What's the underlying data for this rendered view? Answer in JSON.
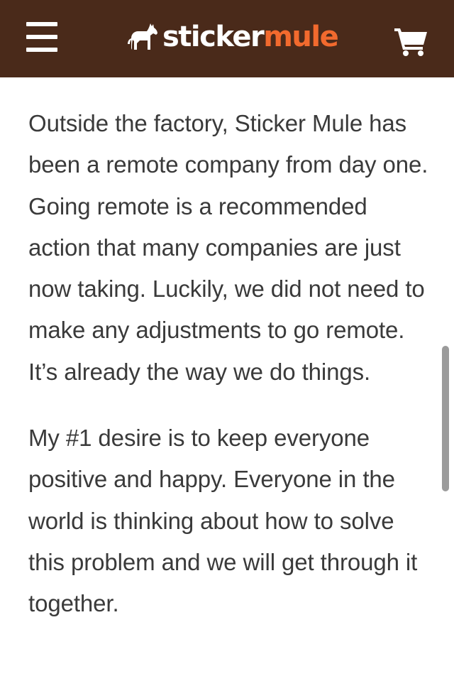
{
  "header": {
    "logo_part1": "sticker",
    "logo_part2": "mule",
    "colors": {
      "background": "#4a2a1a",
      "logo_primary": "#ffffff",
      "logo_accent": "#f26a2e"
    },
    "icons": {
      "menu": "hamburger-menu-icon",
      "logo": "mule-icon",
      "cart": "shopping-cart-icon"
    }
  },
  "article": {
    "paragraphs": [
      "Outside the factory, Sticker Mule has been a remote company from day one. Going remote is a recommended action that many companies are just now taking. Luckily, we did not need to make any adjustments to go remote. It’s already the way we do things.",
      "My #1 desire is to keep everyone positive and happy. Everyone in the world is thinking about how to solve this problem and we will get through it together."
    ],
    "text_color": "#3a3a3a"
  }
}
